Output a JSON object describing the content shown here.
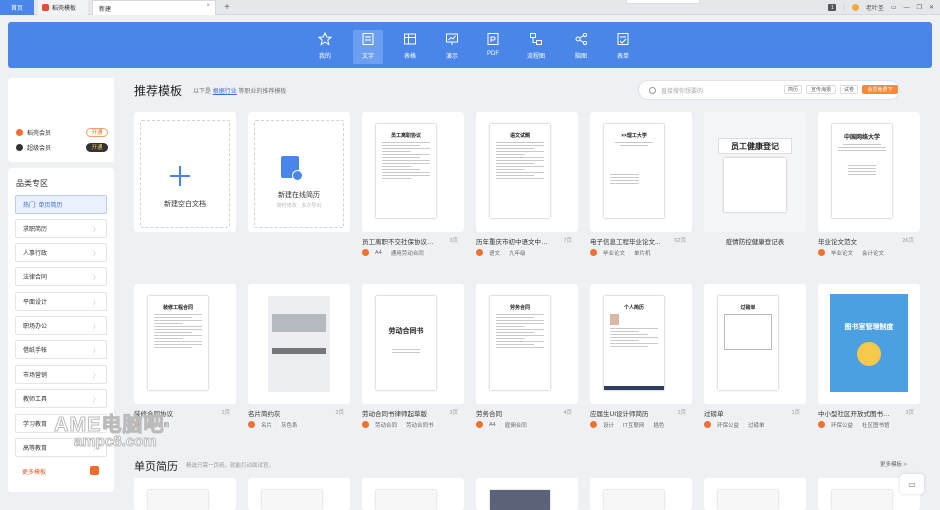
{
  "tabs": {
    "home": "首页",
    "draft": "稻壳模板",
    "new": "新建",
    "user": "老叶圣"
  },
  "toolbar": [
    {
      "label": "我的",
      "icon": "star-icon"
    },
    {
      "label": "文字",
      "icon": "document-icon"
    },
    {
      "label": "表格",
      "icon": "table-icon"
    },
    {
      "label": "演示",
      "icon": "presentation-icon"
    },
    {
      "label": "PDF",
      "icon": "pdf-icon"
    },
    {
      "label": "流程图",
      "icon": "flowchart-icon"
    },
    {
      "label": "脑图",
      "icon": "mindmap-icon"
    },
    {
      "label": "表单",
      "icon": "form-icon"
    }
  ],
  "membership": {
    "daoke": {
      "label": "稻壳会员",
      "button": "开通"
    },
    "super": {
      "label": "超级会员",
      "button": "开通"
    }
  },
  "sidebar": {
    "title": "品类专区",
    "items": [
      "热门: 单页简历",
      "求职简历",
      "人事行政",
      "法律合同",
      "平面设计",
      "职场办公",
      "借纸手帐",
      "市场营销",
      "教师工具",
      "学习教育",
      "高等教育",
      "更多模板"
    ]
  },
  "main": {
    "title": "推荐模板",
    "subtitle_pre": "以下是",
    "subtitle_link": "根据行业",
    "subtitle_post": "等职业的推荐模板",
    "search_placeholder": "直接搜你想要的",
    "chips": [
      "简历",
      "宣传海报",
      "试卷",
      "会员免费下"
    ]
  },
  "blank_cards": {
    "new_doc": "新建空白文档",
    "new_resume": "新建在线简历",
    "resume_sub": "随时修改 · 多次导出"
  },
  "cards_row1": [
    {
      "name": "员工离职不交社保协议书...",
      "pages": "3页",
      "tags": [
        "A4",
        "通用劳动合同"
      ],
      "doc_title": "员工离职协议"
    },
    {
      "name": "历年重庆市初中语文中考...",
      "pages": "7页",
      "tags": [
        "语文",
        "九年级"
      ],
      "doc_title": "语文试题"
    },
    {
      "name": "电子信息工程毕业论文...",
      "pages": "62页",
      "tags": [
        "毕业论文",
        "单片机"
      ],
      "doc_title": "××理工大学"
    },
    {
      "name": "疫情防控健康登记表",
      "pages": "",
      "tags": [],
      "doc_title": "员工健康登记"
    },
    {
      "name": "毕业论文范文",
      "pages": "26页",
      "tags": [
        "毕业论文",
        "会计论文"
      ],
      "doc_title": "中国网络大学"
    }
  ],
  "cards_row2": [
    {
      "name": "装修合同协议",
      "pages": "1页",
      "tags": [
        "装修合同"
      ],
      "doc_title": "装修工程合同"
    },
    {
      "name": "名片简约灰",
      "pages": "2页",
      "tags": [
        "名片",
        "灰色系"
      ],
      "doc_title": ""
    },
    {
      "name": "劳动合同书律师起草版",
      "pages": "3页",
      "tags": [
        "劳动合同",
        "劳动合同书"
      ],
      "doc_title": "劳动合同书"
    },
    {
      "name": "劳务合同",
      "pages": "4页",
      "tags": [
        "A4",
        "雇佣合同"
      ],
      "doc_title": "劳务合同"
    },
    {
      "name": "应届生UI设计师简历",
      "pages": "1页",
      "tags": [
        "设计",
        "IT互联网",
        "插色"
      ],
      "doc_title": "个人简历"
    },
    {
      "name": "过磅单",
      "pages": "1页",
      "tags": [
        "环保公益",
        "过磅单"
      ],
      "doc_title": "过磅单"
    },
    {
      "name": "中小型社区开放式图书馆...",
      "pages": "3页",
      "tags": [
        "环保公益",
        "社区图书馆"
      ],
      "doc_title": "图书室管理制度"
    }
  ],
  "section2": {
    "title": "单页简历",
    "subtitle": "精选只需一页纸，就能打动面试官。",
    "more": "更多模板 >"
  },
  "watermark": {
    "line1": "AME电脑吧",
    "line2": "ampc8.com"
  }
}
